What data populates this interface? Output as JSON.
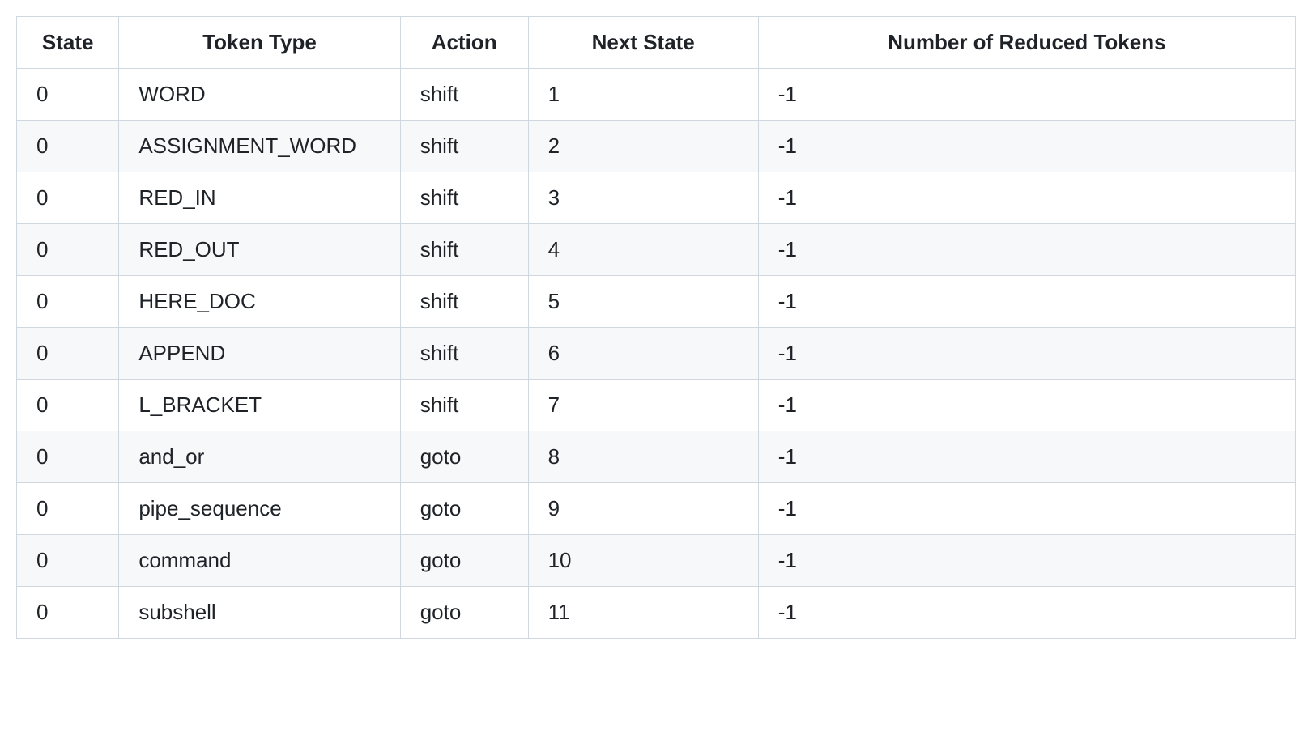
{
  "table": {
    "headers": {
      "state": "State",
      "token_type": "Token Type",
      "action": "Action",
      "next_state": "Next State",
      "reduced": "Number of Reduced Tokens"
    },
    "rows": [
      {
        "state": "0",
        "token_type": "WORD",
        "action": "shift",
        "next_state": "1",
        "reduced": "-1"
      },
      {
        "state": "0",
        "token_type": "ASSIGNMENT_WORD",
        "action": "shift",
        "next_state": "2",
        "reduced": "-1"
      },
      {
        "state": "0",
        "token_type": "RED_IN",
        "action": "shift",
        "next_state": "3",
        "reduced": "-1"
      },
      {
        "state": "0",
        "token_type": "RED_OUT",
        "action": "shift",
        "next_state": "4",
        "reduced": "-1"
      },
      {
        "state": "0",
        "token_type": "HERE_DOC",
        "action": "shift",
        "next_state": "5",
        "reduced": "-1"
      },
      {
        "state": "0",
        "token_type": "APPEND",
        "action": "shift",
        "next_state": "6",
        "reduced": "-1"
      },
      {
        "state": "0",
        "token_type": "L_BRACKET",
        "action": "shift",
        "next_state": "7",
        "reduced": "-1"
      },
      {
        "state": "0",
        "token_type": "and_or",
        "action": "goto",
        "next_state": "8",
        "reduced": "-1"
      },
      {
        "state": "0",
        "token_type": "pipe_sequence",
        "action": "goto",
        "next_state": "9",
        "reduced": "-1"
      },
      {
        "state": "0",
        "token_type": "command",
        "action": "goto",
        "next_state": "10",
        "reduced": "-1"
      },
      {
        "state": "0",
        "token_type": "subshell",
        "action": "goto",
        "next_state": "11",
        "reduced": "-1"
      }
    ]
  }
}
